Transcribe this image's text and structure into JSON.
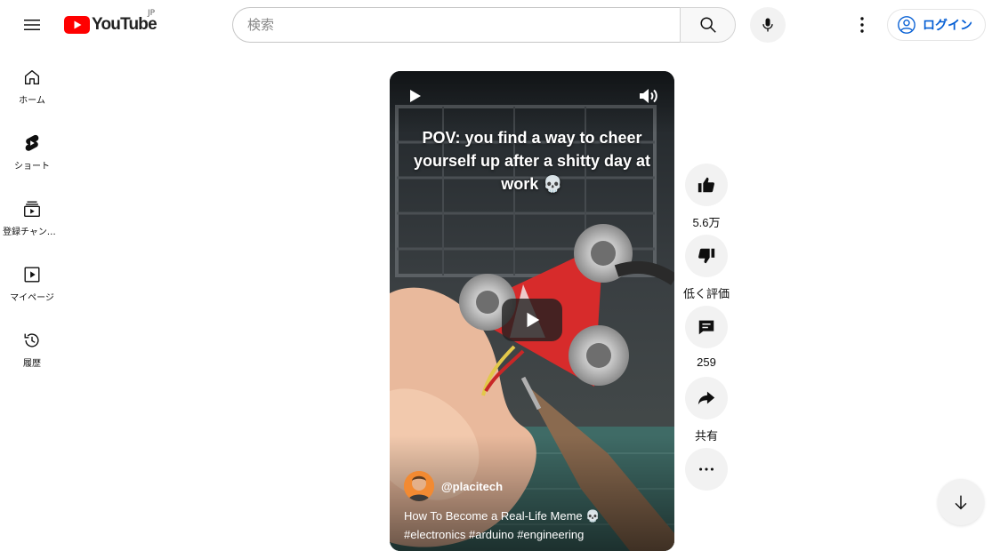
{
  "header": {
    "logo_text": "YouTube",
    "country_code": "JP",
    "search_placeholder": "検索",
    "login_label": "ログイン"
  },
  "guide": {
    "items": [
      {
        "label": "ホーム",
        "icon": "home-icon"
      },
      {
        "label": "ショート",
        "icon": "shorts-icon"
      },
      {
        "label": "登録チャンネル",
        "icon": "subscriptions-icon"
      },
      {
        "label": "マイページ",
        "icon": "library-icon"
      },
      {
        "label": "履歴",
        "icon": "history-icon"
      }
    ]
  },
  "short": {
    "caption": "POV: you find a way to cheer yourself up after a shitty day at work 💀",
    "channel": "@placitech",
    "title": "How To Become a Real-Life Meme 💀",
    "hashtags": "#electronics #arduino #engineering"
  },
  "actions": {
    "like_count": "5.6万",
    "dislike_label": "低く評価",
    "comment_count": "259",
    "share_label": "共有"
  },
  "colors": {
    "brand_red": "#ff0000",
    "link_blue": "#065fd4",
    "button_bg": "#f2f2f2"
  }
}
